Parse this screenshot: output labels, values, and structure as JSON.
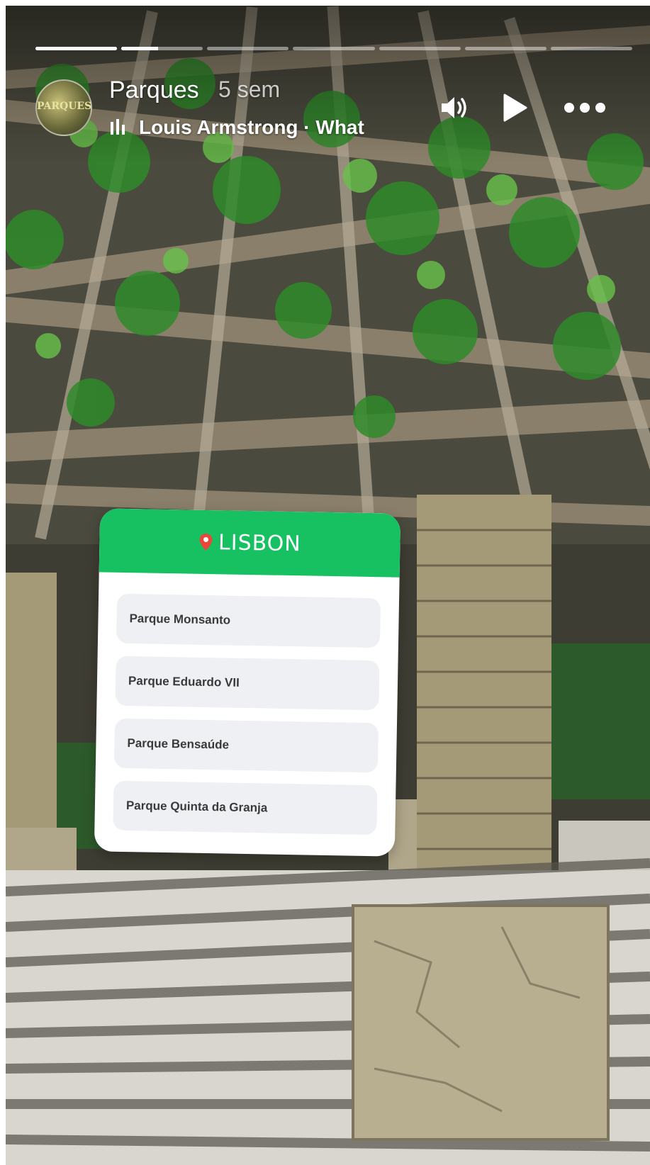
{
  "story": {
    "progress_segments": [
      {
        "fill": 1.0
      },
      {
        "fill": 0.45
      },
      {
        "fill": 0
      },
      {
        "fill": 0
      },
      {
        "fill": 0
      },
      {
        "fill": 0
      },
      {
        "fill": 0
      }
    ],
    "account_name": "Parques",
    "time_ago": "5 sem",
    "music_track": "Louis Armstrong · What",
    "avatar_text": "PARQUES",
    "icons": {
      "sound": "speaker-on-icon",
      "play": "play-icon",
      "more": "more-horizontal-icon",
      "music": "music-bars-icon",
      "pin": "location-pin-icon"
    }
  },
  "sticker": {
    "title": "LISBON",
    "header_color": "#17c161",
    "options": [
      {
        "label": "Parque Monsanto"
      },
      {
        "label": "Parque Eduardo VII"
      },
      {
        "label": "Parque Bensaúde"
      },
      {
        "label": "Parque Quinta da Granja"
      }
    ]
  }
}
